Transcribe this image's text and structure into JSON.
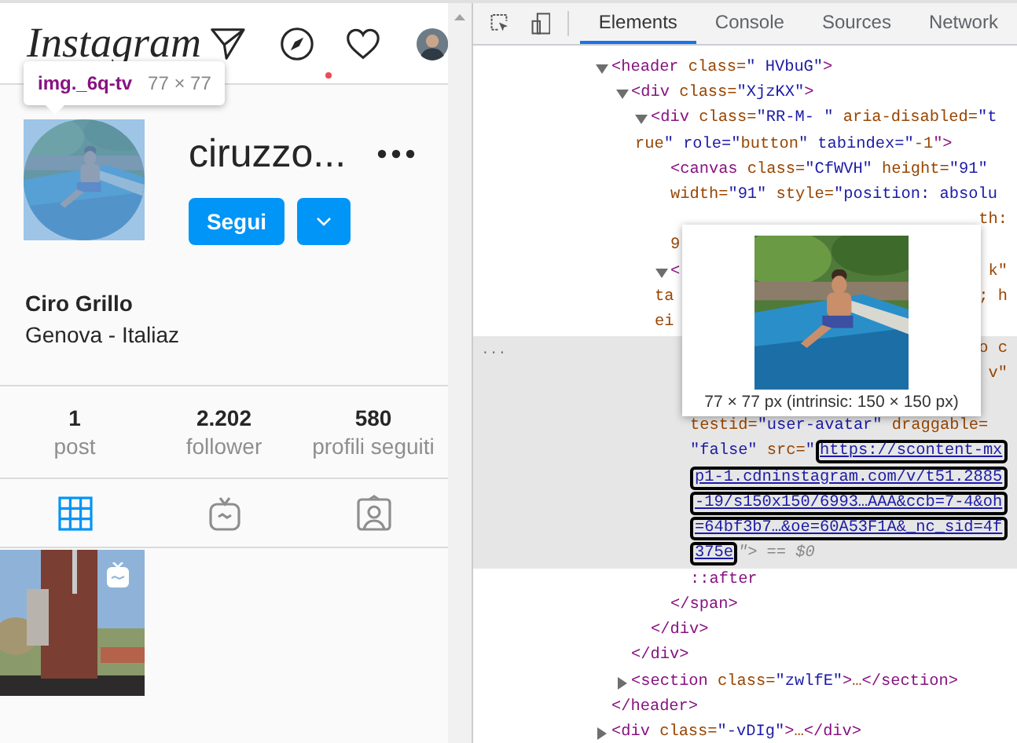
{
  "profile_page": {
    "logo": "Instagram",
    "activity_dot": true,
    "inspect_tooltip": {
      "selector": "img._6q-tv",
      "size": "77 × 77"
    },
    "username": "ciruzzo...",
    "follow_button": "Segui",
    "full_name": "Ciro Grillo",
    "bio": "Genova - Italiaz",
    "stats": [
      {
        "value": "1",
        "label": "post"
      },
      {
        "value": "2.202",
        "label": "follower"
      },
      {
        "value": "580",
        "label": "profili seguiti"
      }
    ],
    "tabs": [
      {
        "kind": "grid",
        "selected": true
      },
      {
        "kind": "igtv",
        "selected": false
      },
      {
        "kind": "tagged",
        "selected": false
      }
    ],
    "posts": [
      {
        "kind": "picture",
        "igtv": true
      }
    ]
  },
  "devtools": {
    "tabs": [
      {
        "label": "Elements",
        "selected": true
      },
      {
        "label": "Console",
        "selected": false
      },
      {
        "label": "Sources",
        "selected": false
      },
      {
        "label": "Network",
        "selected": false
      }
    ],
    "tree": [
      {
        "expanded": true,
        "selected": false,
        "lines": [
          {
            "text": "<header class=\" HVbuG\">"
          }
        ],
        "close": "</header>",
        "children": [
          {
            "expanded": true,
            "selected": false,
            "lines": [
              {
                "text": "<div class=\"XjzKX\">"
              }
            ],
            "close": "</div>",
            "children": [
              {
                "expanded": true,
                "selected": false,
                "lines": [
                  {
                    "text": "<div class=\"RR-M- \" aria-disabled=\"t"
                  },
                  {
                    "text": "rue\" role=\"button\" tabindex=\"-1\">"
                  }
                ],
                "close": "</div>",
                "children": [
                  {
                    "selected": false,
                    "lines": [
                      {
                        "text": "<canvas class=\"CfWVH\" height=\"91\""
                      },
                      {
                        "text": "width=\"91\" style=\"position: absolu"
                      },
                      {
                        "tail": "th:"
                      },
                      {
                        "text": "9"
                      }
                    ]
                  },
                  {
                    "expanded": true,
                    "selected": false,
                    "lines": [
                      {
                        "text": "<",
                        "tail": "k\""
                      },
                      {
                        "text": "ta",
                        "tail": "; h"
                      },
                      {
                        "text": "ei"
                      }
                    ],
                    "close": "</span>",
                    "children": [
                      {
                        "selected": true,
                        "gutter": "...",
                        "lines": [
                          {
                            "tail": "o c"
                          },
                          {
                            "tail": "v\""
                          },
                          {
                            "kind": "covered"
                          },
                          {
                            "text": "testid=\"user-avatar\" draggable="
                          },
                          {
                            "text": "\"false\" src=\"",
                            "link": "https://scontent-mx"
                          },
                          {
                            "link": "p1-1.cdninstagram.com/v/t51.2885"
                          },
                          {
                            "link": "-19/s150x150/6993…AAA&ccb=7-4&oh"
                          },
                          {
                            "link": "=64bf3b7…&oe=60A53F1A&_nc_sid=4f"
                          },
                          {
                            "link": "375e",
                            "after": "\"> == $0"
                          }
                        ]
                      },
                      {
                        "selected": false,
                        "lines": [
                          {
                            "text": "::after"
                          }
                        ]
                      }
                    ]
                  }
                ]
              }
            ]
          },
          {
            "expanded": false,
            "selected": false,
            "lines": [
              {
                "text": "<section class=\"zwlfE\">…</section>"
              }
            ]
          }
        ]
      },
      {
        "expanded": false,
        "selected": false,
        "lines": [
          {
            "text": "<div class=\"-vDIg\">…</div>"
          }
        ]
      }
    ],
    "image_tooltip": {
      "kind": "picture",
      "caption": "77 × 77 px (intrinsic: 150 × 150 px)"
    }
  }
}
